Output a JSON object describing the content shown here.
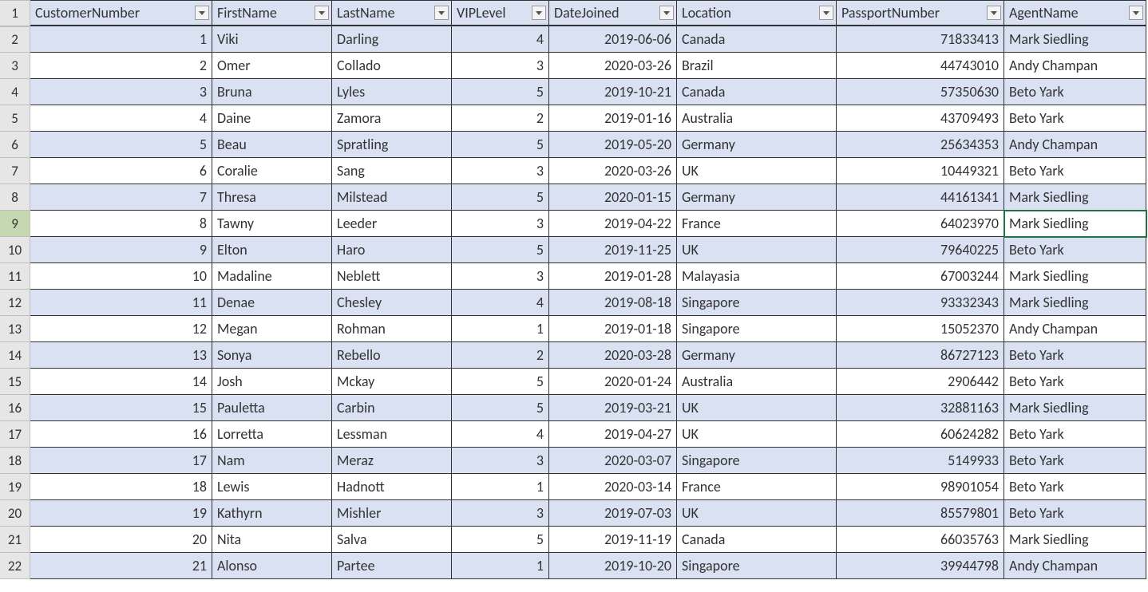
{
  "headers": {
    "col1": "CustomerNumber",
    "col2": "FirstName",
    "col3": "LastName",
    "col4": "VIPLevel",
    "col5": "DateJoined",
    "col6": "Location",
    "col7": "PassportNumber",
    "col8": "AgentName"
  },
  "selected_row": 9,
  "rows": [
    {
      "num": "1"
    },
    {
      "num": "2",
      "c1": "1",
      "c2": "Viki",
      "c3": "Darling",
      "c4": "4",
      "c5": "2019-06-06",
      "c6": "Canada",
      "c7": "71833413",
      "c8": "Mark Siedling"
    },
    {
      "num": "3",
      "c1": "2",
      "c2": "Omer",
      "c3": "Collado",
      "c4": "3",
      "c5": "2020-03-26",
      "c6": "Brazil",
      "c7": "44743010",
      "c8": "Andy Champan"
    },
    {
      "num": "4",
      "c1": "3",
      "c2": "Bruna",
      "c3": "Lyles",
      "c4": "5",
      "c5": "2019-10-21",
      "c6": "Canada",
      "c7": "57350630",
      "c8": "Beto Yark"
    },
    {
      "num": "5",
      "c1": "4",
      "c2": "Daine",
      "c3": "Zamora",
      "c4": "2",
      "c5": "2019-01-16",
      "c6": "Australia",
      "c7": "43709493",
      "c8": "Beto Yark"
    },
    {
      "num": "6",
      "c1": "5",
      "c2": "Beau",
      "c3": "Spratling",
      "c4": "5",
      "c5": "2019-05-20",
      "c6": "Germany",
      "c7": "25634353",
      "c8": "Andy Champan"
    },
    {
      "num": "7",
      "c1": "6",
      "c2": "Coralie",
      "c3": "Sang",
      "c4": "3",
      "c5": "2020-03-26",
      "c6": "UK",
      "c7": "10449321",
      "c8": "Beto Yark"
    },
    {
      "num": "8",
      "c1": "7",
      "c2": "Thresa",
      "c3": "Milstead",
      "c4": "5",
      "c5": "2020-01-15",
      "c6": "Germany",
      "c7": "44161341",
      "c8": "Mark Siedling"
    },
    {
      "num": "9",
      "c1": "8",
      "c2": "Tawny",
      "c3": "Leeder",
      "c4": "3",
      "c5": "2019-04-22",
      "c6": "France",
      "c7": "64023970",
      "c8": "Mark Siedling"
    },
    {
      "num": "10",
      "c1": "9",
      "c2": "Elton",
      "c3": "Haro",
      "c4": "5",
      "c5": "2019-11-25",
      "c6": "UK",
      "c7": "79640225",
      "c8": "Beto Yark"
    },
    {
      "num": "11",
      "c1": "10",
      "c2": "Madaline",
      "c3": "Neblett",
      "c4": "3",
      "c5": "2019-01-28",
      "c6": "Malayasia",
      "c7": "67003244",
      "c8": "Mark Siedling"
    },
    {
      "num": "12",
      "c1": "11",
      "c2": "Denae",
      "c3": "Chesley",
      "c4": "4",
      "c5": "2019-08-18",
      "c6": "Singapore",
      "c7": "93332343",
      "c8": "Mark Siedling"
    },
    {
      "num": "13",
      "c1": "12",
      "c2": "Megan",
      "c3": "Rohman",
      "c4": "1",
      "c5": "2019-01-18",
      "c6": "Singapore",
      "c7": "15052370",
      "c8": "Andy Champan"
    },
    {
      "num": "14",
      "c1": "13",
      "c2": "Sonya",
      "c3": "Rebello",
      "c4": "2",
      "c5": "2020-03-28",
      "c6": "Germany",
      "c7": "86727123",
      "c8": "Beto Yark"
    },
    {
      "num": "15",
      "c1": "14",
      "c2": "Josh",
      "c3": "Mckay",
      "c4": "5",
      "c5": "2020-01-24",
      "c6": "Australia",
      "c7": "2906442",
      "c8": "Beto Yark"
    },
    {
      "num": "16",
      "c1": "15",
      "c2": "Pauletta",
      "c3": "Carbin",
      "c4": "5",
      "c5": "2019-03-21",
      "c6": "UK",
      "c7": "32881163",
      "c8": "Mark Siedling"
    },
    {
      "num": "17",
      "c1": "16",
      "c2": "Lorretta",
      "c3": "Lessman",
      "c4": "4",
      "c5": "2019-04-27",
      "c6": "UK",
      "c7": "60624282",
      "c8": "Beto Yark"
    },
    {
      "num": "18",
      "c1": "17",
      "c2": "Nam",
      "c3": "Meraz",
      "c4": "3",
      "c5": "2020-03-07",
      "c6": "Singapore",
      "c7": "5149933",
      "c8": "Beto Yark"
    },
    {
      "num": "19",
      "c1": "18",
      "c2": "Lewis",
      "c3": "Hadnott",
      "c4": "1",
      "c5": "2020-03-14",
      "c6": "France",
      "c7": "98901054",
      "c8": "Beto Yark"
    },
    {
      "num": "20",
      "c1": "19",
      "c2": "Kathyrn",
      "c3": "Mishler",
      "c4": "3",
      "c5": "2019-07-03",
      "c6": "UK",
      "c7": "85579801",
      "c8": "Beto Yark"
    },
    {
      "num": "21",
      "c1": "20",
      "c2": "Nita",
      "c3": "Salva",
      "c4": "5",
      "c5": "2019-11-19",
      "c6": "Canada",
      "c7": "66035763",
      "c8": "Mark Siedling"
    },
    {
      "num": "22",
      "c1": "21",
      "c2": "Alonso",
      "c3": "Partee",
      "c4": "1",
      "c5": "2019-10-20",
      "c6": "Singapore",
      "c7": "39944798",
      "c8": "Andy Champan"
    }
  ]
}
